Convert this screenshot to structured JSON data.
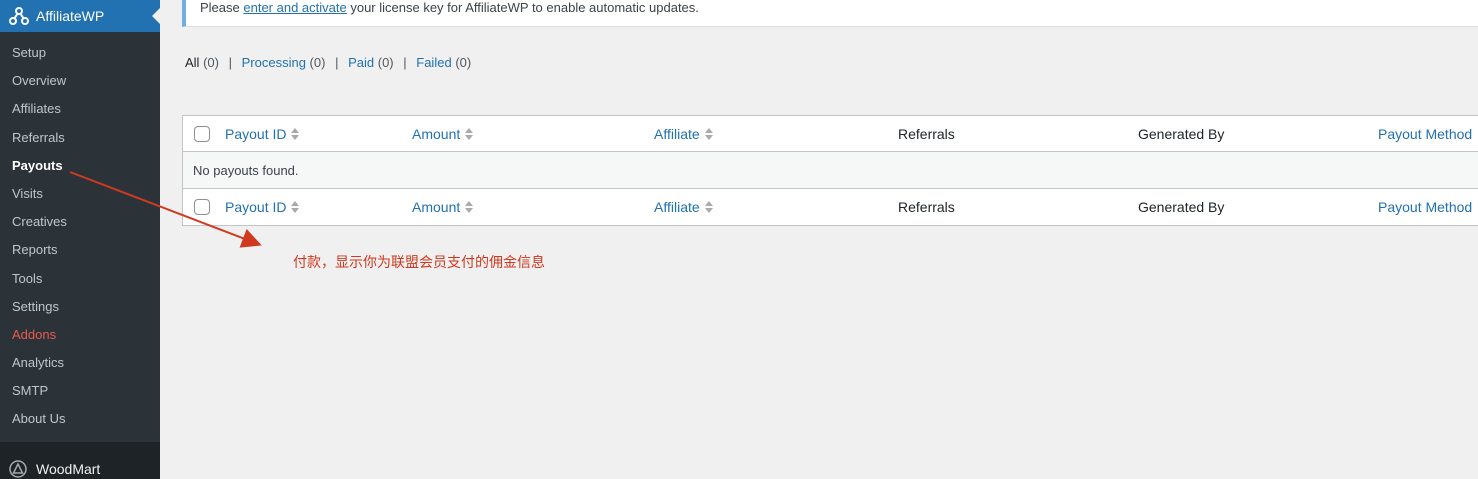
{
  "sidebar": {
    "brand": "AffiliateWP",
    "items": [
      {
        "label": "Setup"
      },
      {
        "label": "Overview"
      },
      {
        "label": "Affiliates"
      },
      {
        "label": "Referrals"
      },
      {
        "label": "Payouts"
      },
      {
        "label": "Visits"
      },
      {
        "label": "Creatives"
      },
      {
        "label": "Reports"
      },
      {
        "label": "Tools"
      },
      {
        "label": "Settings"
      },
      {
        "label": "Addons"
      },
      {
        "label": "Analytics"
      },
      {
        "label": "SMTP"
      },
      {
        "label": "About Us"
      }
    ],
    "next_menu": "WoodMart",
    "current": "Payouts",
    "highlight_color": "#e85a4f"
  },
  "notice": {
    "prefix": "Please ",
    "link": "enter and activate",
    "suffix": " your license key for AffiliateWP to enable automatic updates."
  },
  "filters": [
    {
      "label": "All",
      "count": "(0)",
      "current": true
    },
    {
      "label": "Processing",
      "count": "(0)"
    },
    {
      "label": "Paid",
      "count": "(0)"
    },
    {
      "label": "Failed",
      "count": "(0)"
    }
  ],
  "table": {
    "columns": [
      {
        "label": "Payout ID",
        "sortable": true
      },
      {
        "label": "Amount",
        "sortable": true
      },
      {
        "label": "Affiliate",
        "sortable": true
      },
      {
        "label": "Referrals",
        "sortable": false
      },
      {
        "label": "Generated By",
        "sortable": false
      },
      {
        "label": "Payout Method",
        "sortable": true
      }
    ],
    "empty_message": "No payouts found."
  },
  "annotation": {
    "text": "付款，显示你为联盟会员支付的佣金信息",
    "color": "#d0391f"
  },
  "colors": {
    "accent": "#2271b1",
    "sidebar_bg": "#1d2327",
    "submenu_bg": "#2c3338",
    "page_bg": "#f0f0f1"
  }
}
